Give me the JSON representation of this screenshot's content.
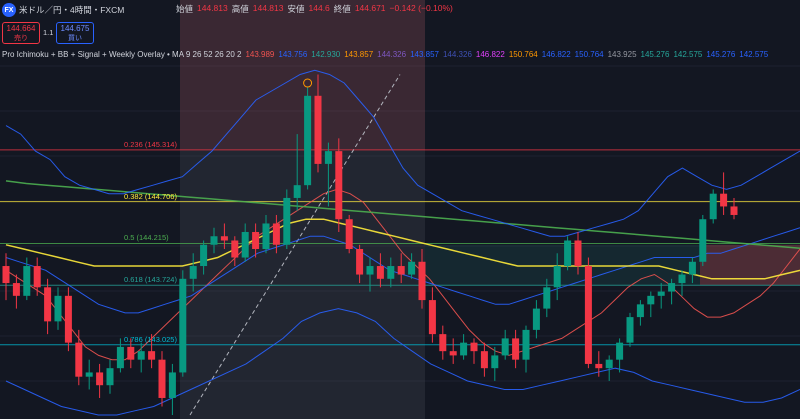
{
  "header": {
    "symbol": "米ドル／円・4時間・FXCM",
    "logo_text": "FX",
    "ohlc": [
      {
        "label": "始値",
        "value": "144.813"
      },
      {
        "label": "高値",
        "value": "144.813"
      },
      {
        "label": "安値",
        "value": "144.6"
      },
      {
        "label": "終値",
        "value": "144.671"
      },
      {
        "label": "",
        "value": "−0.142 (−0.10%)"
      }
    ]
  },
  "trade": {
    "sell_price": "144.664",
    "sell_label": "売り",
    "spread": "1.1",
    "buy_price": "144.675",
    "buy_label": "買い"
  },
  "indicator": {
    "name": "Pro Ichimoku + BB + Signal + Weekly Overlay • MA 9 26 52 26 20 2",
    "values": [
      {
        "v": "143.989",
        "color": "#ef5350"
      },
      {
        "v": "143.756",
        "color": "#2962ff"
      },
      {
        "v": "142.930",
        "color": "#26a69a"
      },
      {
        "v": "143.857",
        "color": "#ff9800"
      },
      {
        "v": "144.326",
        "color": "#7e57c2"
      },
      {
        "v": "143.857",
        "color": "#2962ff"
      },
      {
        "v": "144.326",
        "color": "#3f51b5"
      },
      {
        "v": "146.822",
        "color": "#e040fb"
      },
      {
        "v": "150.764",
        "color": "#ff9800"
      },
      {
        "v": "146.822",
        "color": "#2962ff"
      },
      {
        "v": "150.764",
        "color": "#2962ff"
      },
      {
        "v": "143.925",
        "color": "#9598a1"
      },
      {
        "v": "145.276",
        "color": "#26a69a"
      },
      {
        "v": "142.575",
        "color": "#26a69a"
      },
      {
        "v": "145.276",
        "color": "#2962ff"
      },
      {
        "v": "142.575",
        "color": "#2962ff"
      }
    ]
  },
  "fib_levels": [
    {
      "label": "0.236 (145.314)",
      "price": 145.314,
      "color": "#f23645"
    },
    {
      "label": "0.382 (144.706)",
      "price": 144.706,
      "color": "#ffeb3b"
    },
    {
      "label": "0.5 (144.215)",
      "price": 144.215,
      "color": "#4caf50"
    },
    {
      "label": "0.618 (143.724)",
      "price": 143.724,
      "color": "#26a69a"
    },
    {
      "label": "0.786 (143.025)",
      "price": 143.025,
      "color": "#00bcd4"
    }
  ],
  "chart_data": {
    "type": "candlestick",
    "title": "米ドル／円・4時間・FXCM",
    "ylim": [
      142.2,
      146.3
    ],
    "candles": [
      [
        143.95,
        144.1,
        143.55,
        143.75
      ],
      [
        143.75,
        143.85,
        143.45,
        143.6
      ],
      [
        143.6,
        144.05,
        143.55,
        143.95
      ],
      [
        143.95,
        144.05,
        143.6,
        143.7
      ],
      [
        143.7,
        143.8,
        143.15,
        143.3
      ],
      [
        143.3,
        143.7,
        143.2,
        143.6
      ],
      [
        143.6,
        143.7,
        142.95,
        143.05
      ],
      [
        143.05,
        143.2,
        142.55,
        142.65
      ],
      [
        142.65,
        142.85,
        142.5,
        142.7
      ],
      [
        142.7,
        142.8,
        142.4,
        142.55
      ],
      [
        142.55,
        142.85,
        142.45,
        142.75
      ],
      [
        142.75,
        143.1,
        142.7,
        143.0
      ],
      [
        143.0,
        143.1,
        142.75,
        142.85
      ],
      [
        142.85,
        143.05,
        142.7,
        142.95
      ],
      [
        142.95,
        143.15,
        142.75,
        142.85
      ],
      [
        142.85,
        142.95,
        142.3,
        142.4
      ],
      [
        142.4,
        142.8,
        142.2,
        142.7
      ],
      [
        142.7,
        143.9,
        142.65,
        143.8
      ],
      [
        143.8,
        144.1,
        143.65,
        143.95
      ],
      [
        143.95,
        144.25,
        143.85,
        144.2
      ],
      [
        144.2,
        144.4,
        144.1,
        144.3
      ],
      [
        144.3,
        144.45,
        144.15,
        144.25
      ],
      [
        144.25,
        144.3,
        143.95,
        144.05
      ],
      [
        144.05,
        144.45,
        144.0,
        144.35
      ],
      [
        144.35,
        144.45,
        144.05,
        144.15
      ],
      [
        144.15,
        144.55,
        144.1,
        144.45
      ],
      [
        144.45,
        144.55,
        144.1,
        144.2
      ],
      [
        144.2,
        144.85,
        144.15,
        144.75
      ],
      [
        144.75,
        145.5,
        144.6,
        144.9
      ],
      [
        144.9,
        146.05,
        144.85,
        145.95
      ],
      [
        145.95,
        146.2,
        145.05,
        145.15
      ],
      [
        145.15,
        145.4,
        144.65,
        145.3
      ],
      [
        145.3,
        145.45,
        144.35,
        144.5
      ],
      [
        144.5,
        144.55,
        144.1,
        144.15
      ],
      [
        144.15,
        144.2,
        143.75,
        143.85
      ],
      [
        143.85,
        144.05,
        143.65,
        143.95
      ],
      [
        143.95,
        144.1,
        143.7,
        143.8
      ],
      [
        143.8,
        144.05,
        143.7,
        143.95
      ],
      [
        143.95,
        144.1,
        143.75,
        143.85
      ],
      [
        143.85,
        144.1,
        143.8,
        144.0
      ],
      [
        144.0,
        144.15,
        143.45,
        143.55
      ],
      [
        143.55,
        143.7,
        143.05,
        143.15
      ],
      [
        143.15,
        143.25,
        142.85,
        142.95
      ],
      [
        142.95,
        143.1,
        142.8,
        142.9
      ],
      [
        142.9,
        143.15,
        142.85,
        143.05
      ],
      [
        143.05,
        143.1,
        142.8,
        142.95
      ],
      [
        142.95,
        143.05,
        142.65,
        142.75
      ],
      [
        142.75,
        143.0,
        142.6,
        142.9
      ],
      [
        142.9,
        143.2,
        142.85,
        143.1
      ],
      [
        143.1,
        143.2,
        142.75,
        142.85
      ],
      [
        142.85,
        143.25,
        142.7,
        143.2
      ],
      [
        143.2,
        143.55,
        143.1,
        143.45
      ],
      [
        143.45,
        143.8,
        143.35,
        143.7
      ],
      [
        143.7,
        144.1,
        143.55,
        143.95
      ],
      [
        143.95,
        144.3,
        143.9,
        144.25
      ],
      [
        144.25,
        144.35,
        143.85,
        143.95
      ],
      [
        143.95,
        144.05,
        142.75,
        142.8
      ],
      [
        142.8,
        142.95,
        142.65,
        142.75
      ],
      [
        142.75,
        142.9,
        142.6,
        142.85
      ],
      [
        142.85,
        143.1,
        142.7,
        143.05
      ],
      [
        143.05,
        143.4,
        143.0,
        143.35
      ],
      [
        143.35,
        143.55,
        143.25,
        143.5
      ],
      [
        143.5,
        143.65,
        143.35,
        143.6
      ],
      [
        143.6,
        143.75,
        143.45,
        143.65
      ],
      [
        143.65,
        143.8,
        143.5,
        143.75
      ],
      [
        143.75,
        143.9,
        143.6,
        143.85
      ],
      [
        143.85,
        144.05,
        143.75,
        144.0
      ],
      [
        144.0,
        144.55,
        143.95,
        144.5
      ],
      [
        144.5,
        144.85,
        144.45,
        144.8
      ],
      [
        144.8,
        145.05,
        144.55,
        144.65
      ],
      [
        144.65,
        144.75,
        144.5,
        144.55
      ]
    ],
    "lines": [
      {
        "name": "MA 9",
        "color": "#ef5350",
        "width": 1,
        "values": [
          143.9,
          143.8,
          143.7,
          143.6,
          143.4,
          143.2,
          143.0,
          142.9,
          142.85,
          142.85,
          142.95,
          143.1,
          143.25,
          143.4,
          143.55,
          143.7,
          143.85,
          144.0,
          144.15,
          144.3,
          144.4,
          144.5,
          144.6,
          144.7,
          144.8,
          144.85,
          144.8,
          144.7,
          144.5,
          144.3,
          144.1,
          143.95,
          143.8,
          143.6,
          143.4,
          143.2,
          143.05,
          142.95,
          142.9,
          142.95,
          143.0,
          143.05,
          143.1,
          143.2,
          143.3,
          143.4,
          143.55,
          143.7,
          143.8,
          143.85,
          143.75,
          143.6,
          143.45,
          143.35,
          143.35,
          143.4,
          143.5,
          143.6,
          143.75,
          143.95,
          144.15
        ]
      },
      {
        "name": "MA 26",
        "color": "#2962ff",
        "width": 1,
        "values": [
          144.05,
          144.0,
          143.95,
          143.9,
          143.8,
          143.7,
          143.6,
          143.5,
          143.45,
          143.4,
          143.4,
          143.45,
          143.5,
          143.55,
          143.6,
          143.7,
          143.8,
          143.9,
          144.0,
          144.1,
          144.15,
          144.2,
          144.25,
          144.3,
          144.3,
          144.25,
          144.2,
          144.1,
          144.0,
          143.9,
          143.85,
          143.8,
          143.75,
          143.7,
          143.65,
          143.6,
          143.55,
          143.5,
          143.5,
          143.55,
          143.6,
          143.65,
          143.7,
          143.75,
          143.8,
          143.85,
          143.9,
          143.95,
          144.0,
          144.05,
          144.05,
          144.05,
          144.05,
          144.1,
          144.1,
          144.15,
          144.2,
          144.25,
          144.3,
          144.35,
          144.4
        ]
      },
      {
        "name": "Weekly MA",
        "color": "#ffeb3b",
        "width": 1.5,
        "values": [
          144.2,
          144.15,
          144.1,
          144.05,
          144.0,
          143.95,
          143.95,
          143.95,
          143.95,
          143.95,
          143.95,
          144.0,
          144.05,
          144.15,
          144.25,
          144.35,
          144.45,
          144.5,
          144.5,
          144.45,
          144.4,
          144.35,
          144.3,
          144.25,
          144.2,
          144.15,
          144.1,
          144.05,
          144.0,
          143.95,
          143.95,
          143.95,
          143.95,
          143.95,
          143.95,
          143.95,
          143.95,
          143.95,
          143.9,
          143.85,
          143.8,
          143.8,
          143.8,
          143.8,
          143.85,
          143.9
        ]
      },
      {
        "name": "Ichimoku Base",
        "color": "#4caf50",
        "width": 1.5,
        "values": [
          144.95,
          144.92,
          144.9,
          144.88,
          144.86,
          144.84,
          144.82,
          144.8,
          144.78,
          144.76,
          144.74,
          144.72,
          144.7,
          144.68,
          144.66,
          144.64,
          144.62,
          144.6,
          144.58,
          144.56,
          144.54,
          144.52,
          144.5,
          144.48,
          144.46,
          144.44,
          144.42,
          144.4,
          144.38,
          144.36,
          144.34,
          144.32,
          144.3,
          144.28,
          144.26,
          144.24,
          144.22,
          144.2,
          144.18,
          144.16
        ]
      },
      {
        "name": "BB Upper",
        "color": "#2962ff",
        "width": 1,
        "values": [
          145.6,
          145.5,
          145.3,
          145.2,
          145.0,
          144.9,
          144.85,
          144.8,
          144.8,
          144.85,
          144.9,
          144.95,
          145.0,
          145.15,
          145.3,
          145.5,
          145.7,
          145.9,
          146.0,
          146.1,
          146.2,
          146.25,
          146.2,
          146.1,
          145.9,
          145.7,
          145.4,
          145.1,
          144.9,
          144.8,
          144.7,
          144.6,
          144.55,
          144.5,
          144.45,
          144.4,
          144.35,
          144.3,
          144.3,
          144.35,
          144.4,
          144.45,
          144.5,
          144.6,
          144.8,
          145.0,
          145.1,
          145.0,
          144.9,
          144.85,
          144.9,
          145.0,
          145.1,
          145.2,
          145.3
        ]
      },
      {
        "name": "BB Lower",
        "color": "#2962ff",
        "width": 1,
        "values": [
          142.6,
          142.5,
          142.4,
          142.3,
          142.25,
          142.2,
          142.2,
          142.25,
          142.3,
          142.4,
          142.5,
          142.6,
          142.7,
          142.8,
          142.95,
          143.1,
          143.3,
          143.4,
          143.45,
          143.4,
          143.3,
          143.1,
          142.95,
          142.8,
          142.7,
          142.6,
          142.55,
          142.5,
          142.5,
          142.55,
          142.6,
          142.65,
          142.7,
          142.75,
          142.7,
          142.6,
          142.55,
          142.5,
          142.45,
          142.4,
          142.35,
          142.35,
          142.4,
          142.5
        ]
      }
    ]
  }
}
